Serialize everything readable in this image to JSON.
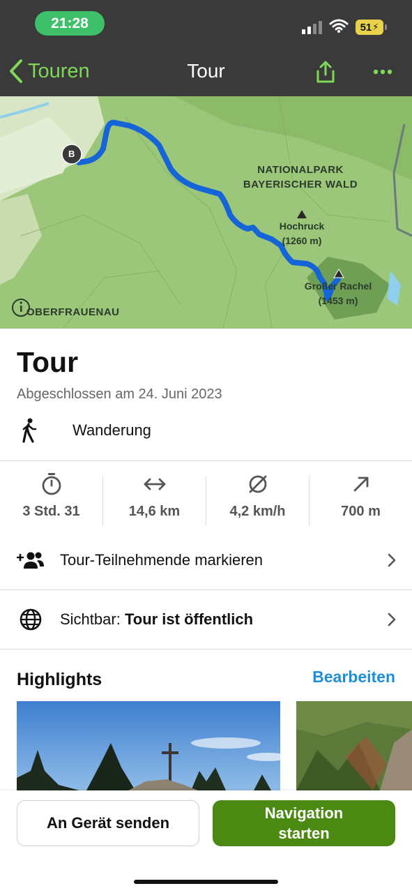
{
  "status_bar": {
    "time": "21:28",
    "battery": "51"
  },
  "nav": {
    "back_label": "Touren",
    "title": "Tour"
  },
  "map": {
    "park_label_line1": "NATIONALPARK",
    "park_label_line2": "BAYERISCHER WALD",
    "peak1_name": "Hochruck",
    "peak1_elev": "(1260 m)",
    "peak2_name": "Großer Rachel",
    "peak2_elev": "(1453 m)",
    "town_label": "OBERFRAUENAU",
    "marker_label": "B",
    "route_color": "#1565d8"
  },
  "tour": {
    "title": "Tour",
    "completed_date": "Abgeschlossen am 24. Juni 2023",
    "activity": "Wanderung"
  },
  "stats": [
    {
      "icon": "stopwatch-icon",
      "value": "3 Std. 31"
    },
    {
      "icon": "distance-arrows-icon",
      "value": "14,6 km"
    },
    {
      "icon": "average-speed-icon",
      "value": "4,2 km/h"
    },
    {
      "icon": "elevation-up-icon",
      "value": "700 m"
    }
  ],
  "rows": {
    "participants_label": "Tour-Teilnehmende markieren",
    "visibility_prefix": "Sichtbar:",
    "visibility_value": "Tour ist öffentlich"
  },
  "highlights": {
    "heading": "Highlights",
    "edit_label": "Bearbeiten"
  },
  "actions": {
    "send_label": "An Gerät senden",
    "navigate_label": "Navigation\nstarten"
  },
  "colors": {
    "accent_green": "#7ed957",
    "primary_button": "#4a8a12",
    "link_blue": "#1f8ed6"
  }
}
